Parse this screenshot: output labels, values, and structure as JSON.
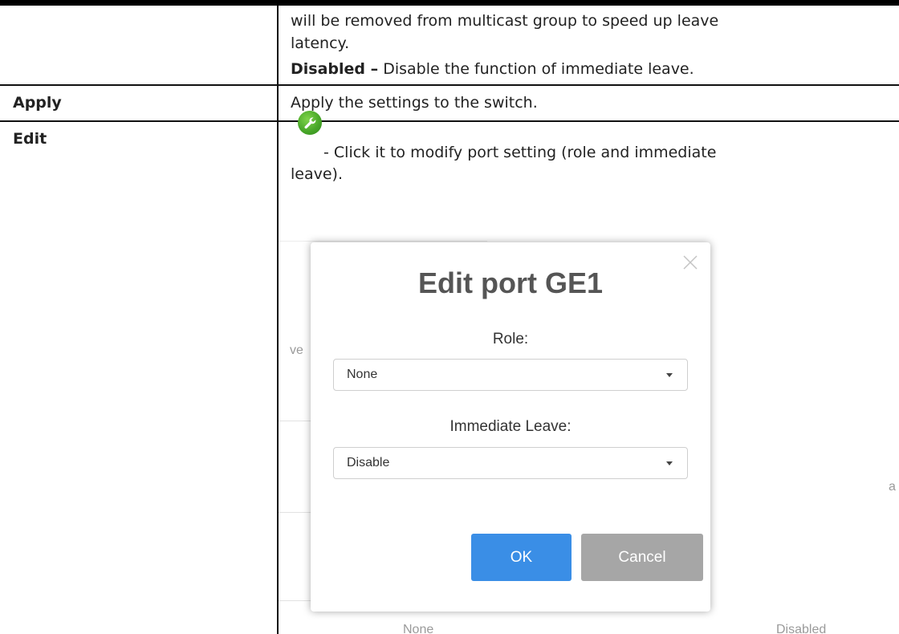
{
  "intro": {
    "line1": "will be removed from multicast group to speed up leave",
    "line2": "latency.",
    "disabled_term": "Disabled –",
    "disabled_desc": "Disable the function of immediate leave."
  },
  "rows": {
    "apply": {
      "term": "Apply",
      "desc": "Apply the settings to the switch."
    },
    "edit": {
      "term": "Edit",
      "desc_line1": "- Click it to modify port setting (role and immediate",
      "desc_line2": "leave)."
    }
  },
  "dialog": {
    "title": "Edit port GE1",
    "role_label": "Role:",
    "role_value": "None",
    "leave_label": "Immediate Leave:",
    "leave_value": "Disable",
    "ok_label": "OK",
    "cancel_label": "Cancel",
    "icons": {
      "close": "close-icon",
      "caret": "chevron-down-icon",
      "edit": "wrench-icon"
    }
  },
  "background": {
    "left_fragment": "ve",
    "right_fragment": "a",
    "bottom_left": "None",
    "bottom_right": "Disabled"
  },
  "colors": {
    "ok": "#3a8ee6",
    "cancel": "#a6a6a6",
    "icon": "#4aa82a"
  }
}
